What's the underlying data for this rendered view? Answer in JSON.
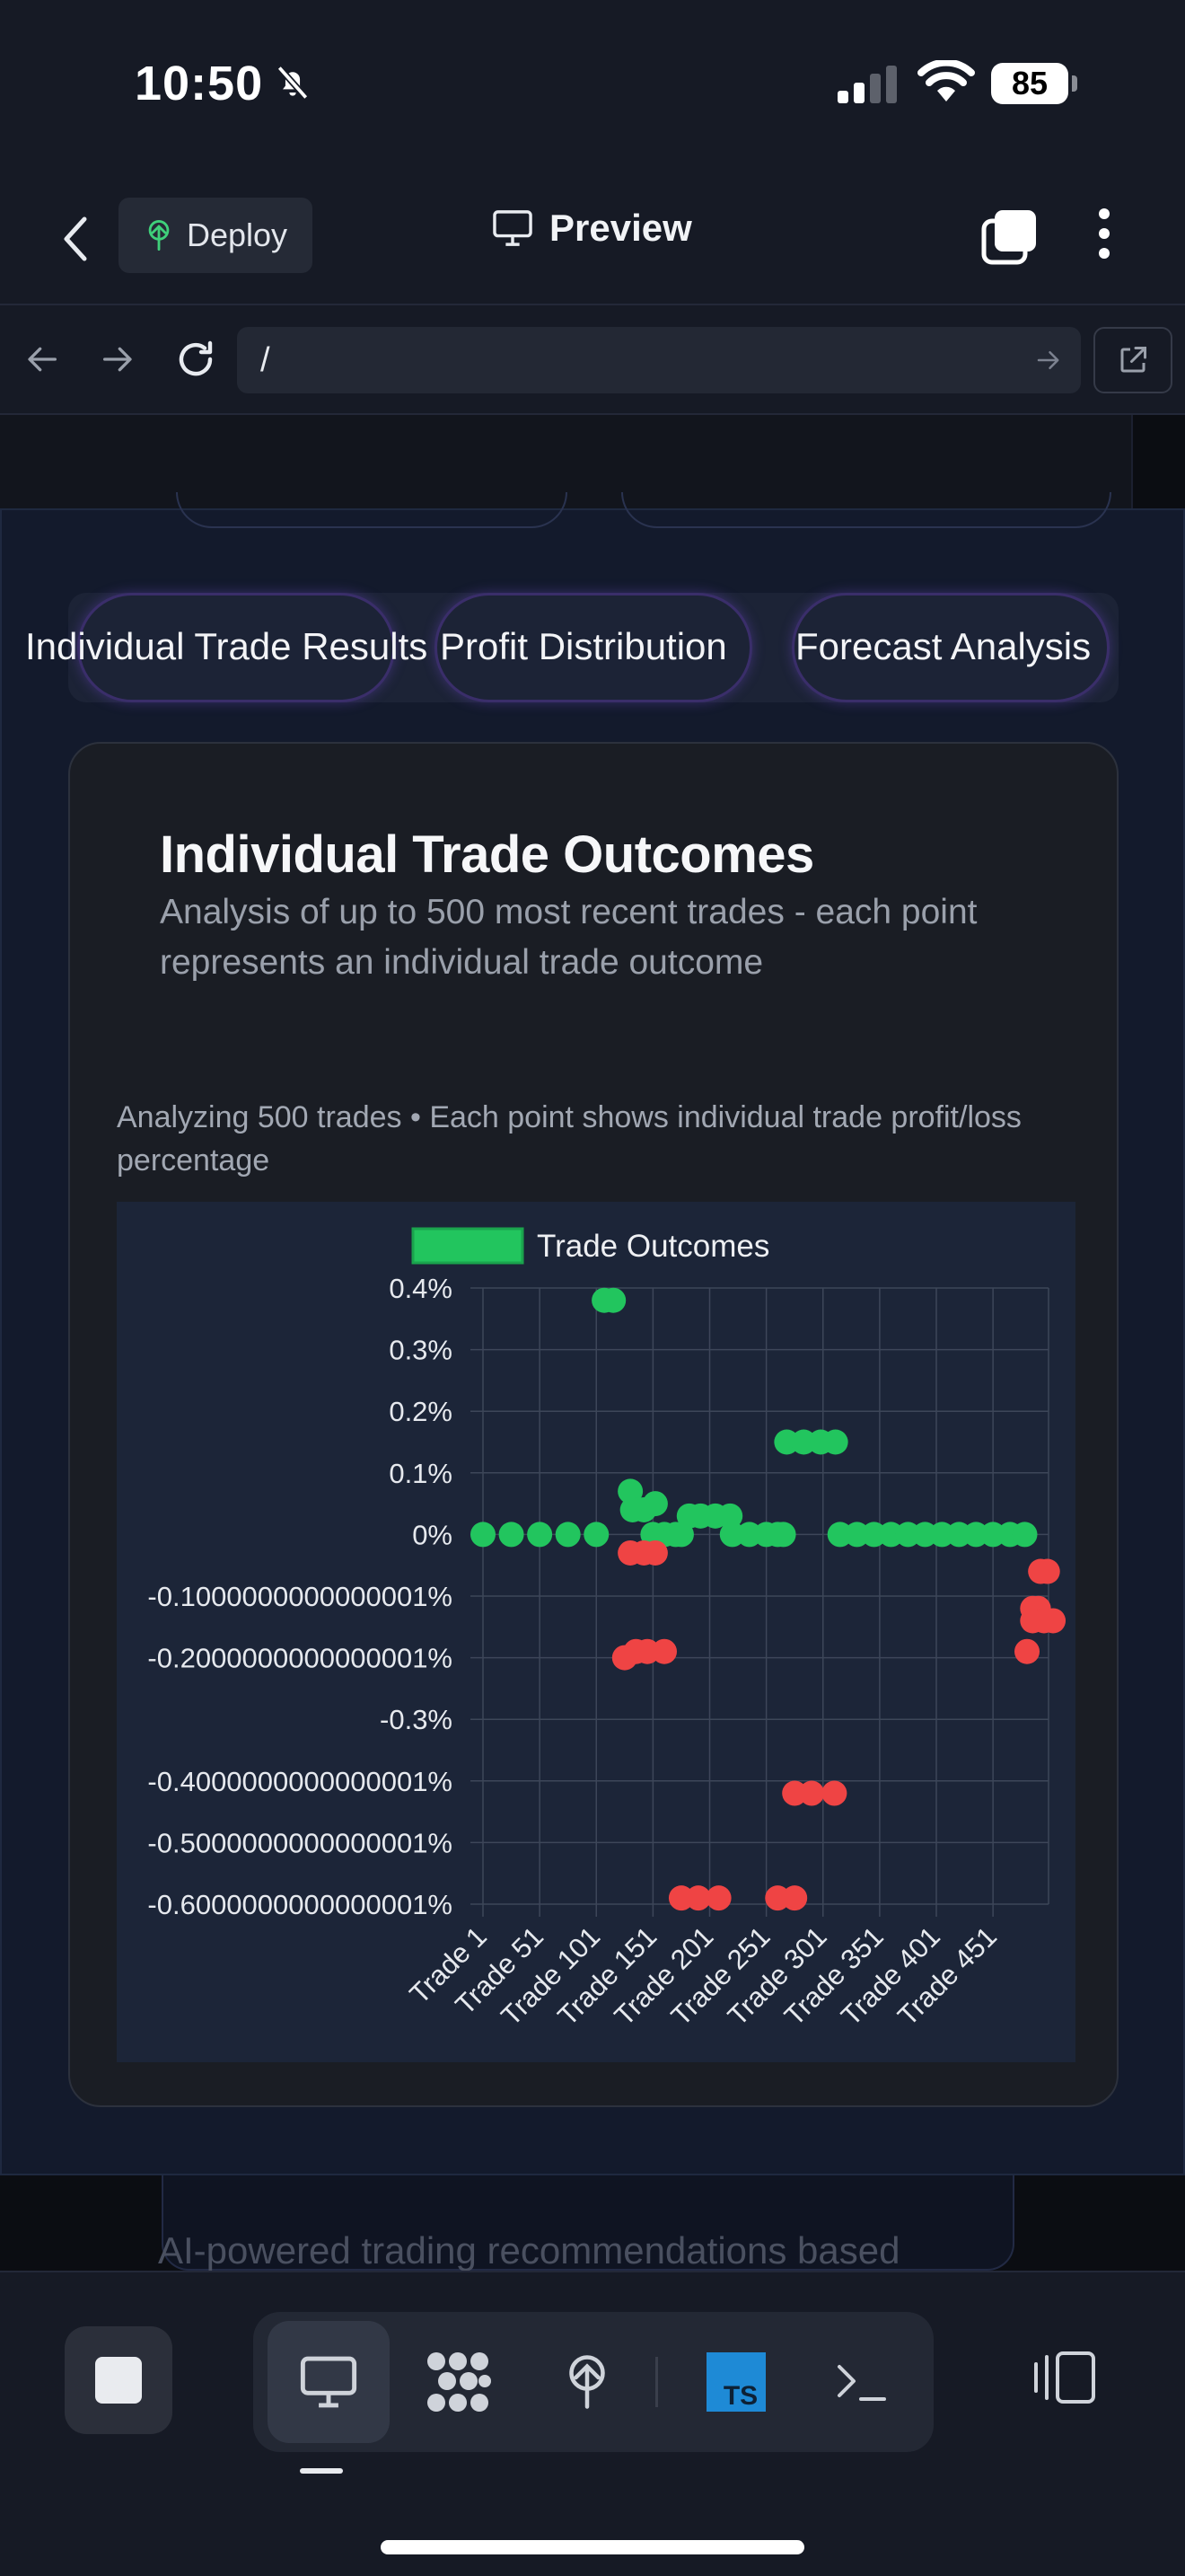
{
  "status_bar": {
    "time": "10:50",
    "battery": "85"
  },
  "header": {
    "deploy_label": "Deploy",
    "preview_label": "Preview"
  },
  "url_bar": {
    "url": "/"
  },
  "tabs": [
    {
      "label": "Individual Trade Results"
    },
    {
      "label": "Profit Distribution"
    },
    {
      "label": "Forecast Analysis"
    }
  ],
  "card": {
    "title": "Individual Trade Outcomes",
    "subtitle": "Analysis of up to 500 most recent trades - each point represents an individual trade outcome",
    "caption": "Analyzing 500 trades • Each point shows individual trade profit/loss percentage"
  },
  "below_fold_text": "AI-powered trading recommendations based",
  "colors": {
    "profit": "#22c55e",
    "loss": "#ef4444",
    "chart_bg": "#1c2538",
    "grid": "#3d4659"
  },
  "chart_data": {
    "type": "scatter",
    "legend": [
      "Trade Outcomes"
    ],
    "legend_position": "top",
    "grid": true,
    "ylim": [
      -0.6000000000000001,
      0.4
    ],
    "y_ticks": [
      "0.4%",
      "0.3%",
      "0.2%",
      "0.1%",
      "0%",
      "-0.1000000000000001%",
      "-0.2000000000000001%",
      "-0.3%",
      "-0.4000000000000001%",
      "-0.5000000000000001%",
      "-0.6000000000000001%"
    ],
    "y_tick_values": [
      0.4,
      0.3,
      0.2,
      0.1,
      0,
      -0.1,
      -0.2,
      -0.3,
      -0.4,
      -0.5,
      -0.6
    ],
    "x_ticks": [
      "Trade 1",
      "Trade 51",
      "Trade 101",
      "Trade 151",
      "Trade 201",
      "Trade 251",
      "Trade 301",
      "Trade 351",
      "Trade 401",
      "Trade 451"
    ],
    "x_tick_values": [
      1,
      51,
      101,
      151,
      201,
      251,
      301,
      351,
      401,
      451
    ],
    "xlim": [
      1,
      500
    ],
    "series": [
      {
        "name": "Trade Outcomes",
        "color": "#22c55e",
        "points": [
          [
            1,
            0
          ],
          [
            26,
            0
          ],
          [
            51,
            0
          ],
          [
            76,
            0
          ],
          [
            101,
            0
          ],
          [
            108,
            0.38
          ],
          [
            116,
            0.38
          ],
          [
            131,
            0.07
          ],
          [
            133,
            0.04
          ],
          [
            143,
            0.04
          ],
          [
            153,
            0.05
          ],
          [
            151,
            0
          ],
          [
            161,
            0
          ],
          [
            171,
            0
          ],
          [
            176,
            0
          ],
          [
            183,
            0.03
          ],
          [
            193,
            0.03
          ],
          [
            206,
            0.03
          ],
          [
            219,
            0.03
          ],
          [
            221,
            0
          ],
          [
            236,
            0
          ],
          [
            251,
            0
          ],
          [
            261,
            0
          ],
          [
            266,
            0
          ],
          [
            269,
            0.15
          ],
          [
            284,
            0.15
          ],
          [
            299,
            0.15
          ],
          [
            312,
            0.15
          ],
          [
            316,
            0
          ],
          [
            331,
            0
          ],
          [
            346,
            0
          ],
          [
            361,
            0
          ],
          [
            376,
            0
          ],
          [
            391,
            0
          ],
          [
            406,
            0
          ],
          [
            421,
            0
          ],
          [
            436,
            0
          ],
          [
            451,
            0
          ],
          [
            466,
            0
          ],
          [
            479,
            0
          ]
        ]
      },
      {
        "name": "",
        "color": "#ef4444",
        "points": [
          [
            131,
            -0.03
          ],
          [
            143,
            -0.03
          ],
          [
            153,
            -0.03
          ],
          [
            126,
            -0.2
          ],
          [
            136,
            -0.19
          ],
          [
            146,
            -0.19
          ],
          [
            161,
            -0.19
          ],
          [
            176,
            -0.59
          ],
          [
            191,
            -0.59
          ],
          [
            209,
            -0.59
          ],
          [
            261,
            -0.59
          ],
          [
            276,
            -0.59
          ],
          [
            276,
            -0.42
          ],
          [
            291,
            -0.42
          ],
          [
            311,
            -0.42
          ],
          [
            493,
            -0.06
          ],
          [
            499,
            -0.06
          ],
          [
            486,
            -0.12
          ],
          [
            491,
            -0.12
          ],
          [
            486,
            -0.14
          ],
          [
            496,
            -0.14
          ],
          [
            504,
            -0.14
          ],
          [
            481,
            -0.19
          ]
        ]
      }
    ]
  }
}
